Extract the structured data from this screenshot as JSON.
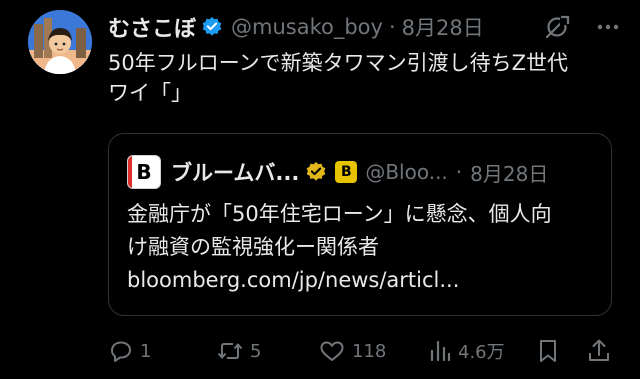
{
  "tweet": {
    "author_name": "むさこぼ",
    "handle": "@musako_boy",
    "separator": "·",
    "date": "8月28日",
    "text_lines": [
      "50年フルローンで新築タワマン引渡し待ちZ世代",
      "ワイ「」"
    ]
  },
  "quote": {
    "logo_letter": "B",
    "author_name": "ブルームバ...",
    "org_badge_letter": "B",
    "handle": "@Bloo...",
    "separator": "·",
    "date": "8月28日",
    "text_lines": [
      "金融庁が「50年住宅ローン」に懸念、個人向",
      "け融資の監視強化ー関係者",
      "bloomberg.com/jp/news/articl..."
    ]
  },
  "actions": {
    "replies": "1",
    "reposts": "5",
    "likes": "118",
    "views": "4.6万"
  },
  "icons": {
    "verified": "verified-badge-icon",
    "grok": "grok-icon",
    "more": "more-icon",
    "reply": "reply-icon",
    "repost": "repost-icon",
    "like": "like-icon",
    "views": "views-icon",
    "bookmark": "bookmark-icon",
    "share": "share-icon"
  },
  "colors": {
    "background": "#000000",
    "text": "#e7e9ea",
    "muted": "#71767b",
    "verified_blue": "#1d9bf0",
    "verified_gold": "#e2b719"
  }
}
